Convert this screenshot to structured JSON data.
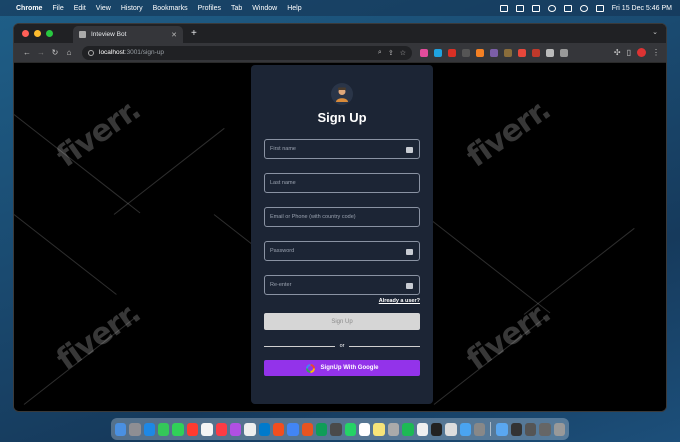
{
  "menubar": {
    "app_name": "Chrome",
    "items": [
      "File",
      "Edit",
      "View",
      "History",
      "Bookmarks",
      "Profiles",
      "Tab",
      "Window",
      "Help"
    ],
    "datetime": "Fri 15 Dec  5:46 PM"
  },
  "browser": {
    "tab_title": "Inteview Bot",
    "url_host": "localhost",
    "url_path": ":3001/sign-up"
  },
  "watermark_text": "fiverr.",
  "signup": {
    "title": "Sign Up",
    "first_name_placeholder": "First name",
    "last_name_placeholder": "Last name",
    "contact_placeholder": "Email or Phone (with country code)",
    "password_placeholder": "Password",
    "reenter_placeholder": "Re-enter",
    "already_user_link": "Already a user?",
    "signup_button": "Sign Up",
    "divider_text": "or",
    "google_button": "SignUp With Google"
  },
  "colors": {
    "card_bg": "#1c2535",
    "google_button_bg": "#9333ea",
    "signup_button_bg": "#d6d6d6"
  }
}
